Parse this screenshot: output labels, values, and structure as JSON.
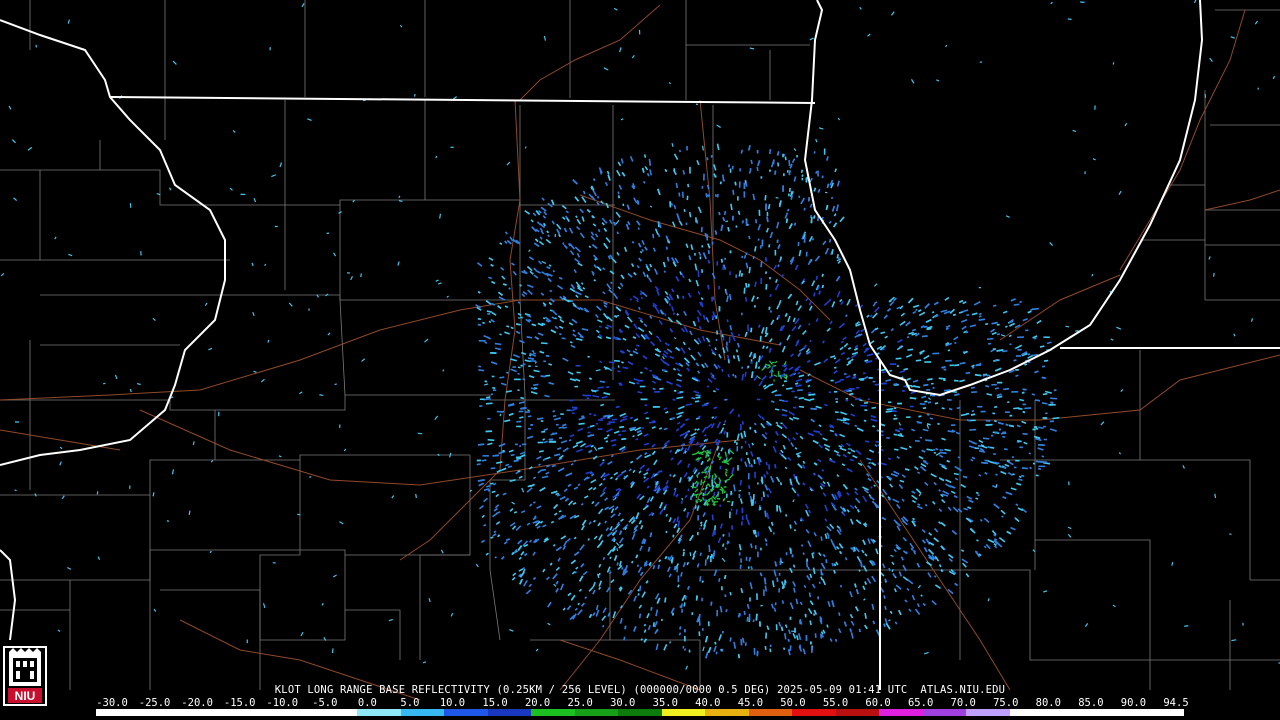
{
  "product_caption": "KLOT LONG RANGE BASE REFLECTIVITY (0.25KM / 256 LEVEL) (000000/0000 0.5 DEG) 2025-05-09 01:41 UTC  ATLAS.NIU.EDU",
  "logo_text": "NIU",
  "scale_labels": [
    "-30.0",
    "-25.0",
    "-20.0",
    "-15.0",
    "-10.0",
    "-5.0",
    "0.0",
    "5.0",
    "10.0",
    "15.0",
    "20.0",
    "25.0",
    "30.0",
    "35.0",
    "40.0",
    "45.0",
    "50.0",
    "55.0",
    "60.0",
    "65.0",
    "70.0",
    "75.0",
    "80.0",
    "85.0",
    "90.0",
    "94.5"
  ],
  "colors": {
    "background": "#000000",
    "state_lines": "#ffffff",
    "county_lines": "#808080",
    "roads": "#a0522d",
    "echo_light": "#3fc8f0",
    "echo_mid": "#2f7fe0",
    "echo_dense": "#1f3fd0",
    "echo_green": "#22c040"
  },
  "color_scale": [
    "#ffffff",
    "#ffffff",
    "#ffffff",
    "#ffffff",
    "#ffffff",
    "#ffffff",
    "#8ee8f8",
    "#38b8f0",
    "#1f58e8",
    "#1838c0",
    "#1cc020",
    "#17a017",
    "#0c7c0c",
    "#f0f020",
    "#e8b010",
    "#e06010",
    "#e01010",
    "#b81010",
    "#e020e0",
    "#a040e0",
    "#c0a0ff",
    "#ffffff",
    "#ffffff",
    "#ffffff",
    "#ffffff"
  ]
}
